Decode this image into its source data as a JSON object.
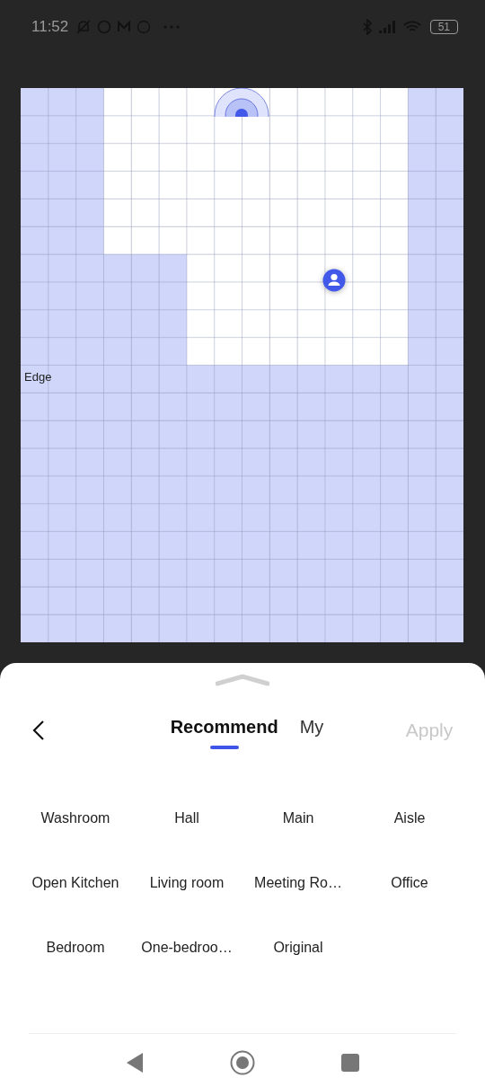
{
  "status_bar": {
    "time": "11:52",
    "battery": "51"
  },
  "map": {
    "label": "Edge"
  },
  "sheet": {
    "tabs": [
      {
        "label": "Recommend",
        "selected": true
      },
      {
        "label": "My",
        "selected": false
      }
    ],
    "apply": {
      "label": "Apply",
      "disabled": true
    },
    "templates": [
      "Washroom",
      "Hall",
      "Main",
      "Aisle",
      "Open Kitchen",
      "Living room",
      "Meeting Ro…",
      "Office",
      "Bedroom",
      "One-bedroo…",
      "Original"
    ]
  }
}
